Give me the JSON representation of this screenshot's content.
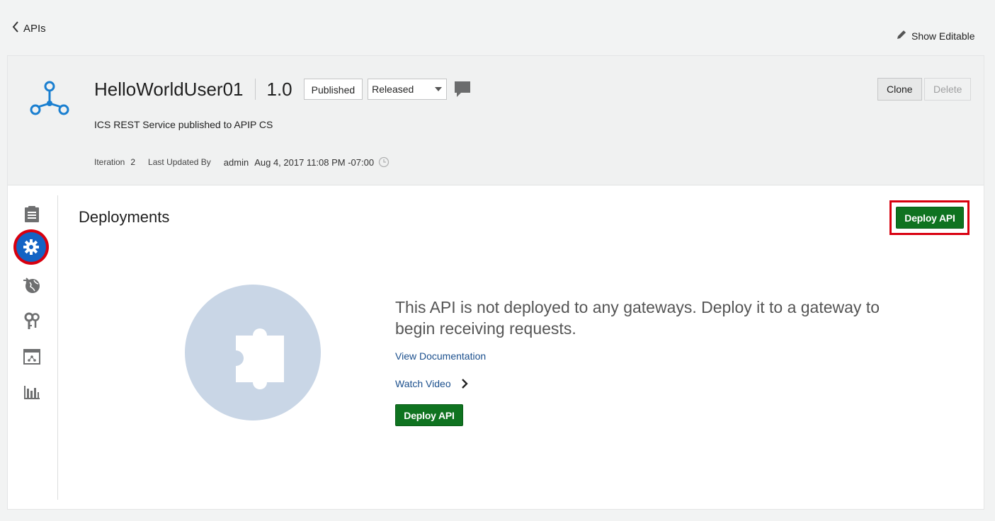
{
  "nav": {
    "back_label": "APIs",
    "show_editable_label": "Show Editable"
  },
  "api": {
    "name": "HelloWorldUser01",
    "version": "1.0",
    "publish_badge": "Published",
    "state_select": "Released",
    "description": "ICS REST Service published to APIP CS",
    "iteration_label": "Iteration",
    "iteration_value": "2",
    "updated_by_label": "Last Updated By",
    "updated_by_value": "admin",
    "updated_date": "Aug 4, 2017 11:08 PM -07:00"
  },
  "actions": {
    "clone_label": "Clone",
    "delete_label": "Delete"
  },
  "side_nav": [
    {
      "icon": "clipboard-icon"
    },
    {
      "icon": "gear-icon",
      "active": true
    },
    {
      "icon": "globe-deploy-icon"
    },
    {
      "icon": "keys-icon"
    },
    {
      "icon": "portal-icon"
    },
    {
      "icon": "bar-chart-icon"
    }
  ],
  "deployments": {
    "title": "Deployments",
    "deploy_button_label": "Deploy API",
    "empty_message": "This API is not deployed to any gateways. Deploy it to a gateway to begin receiving requests.",
    "view_docs_label": "View Documentation",
    "watch_video_label": "Watch Video",
    "deploy_button_label_2": "Deploy API"
  },
  "colors": {
    "accent_blue": "#1463c4",
    "deploy_green": "#0f7320",
    "highlight_red": "#d9000f",
    "link_blue": "#1b4f8d",
    "illustration_bg": "#c9d6e6"
  }
}
